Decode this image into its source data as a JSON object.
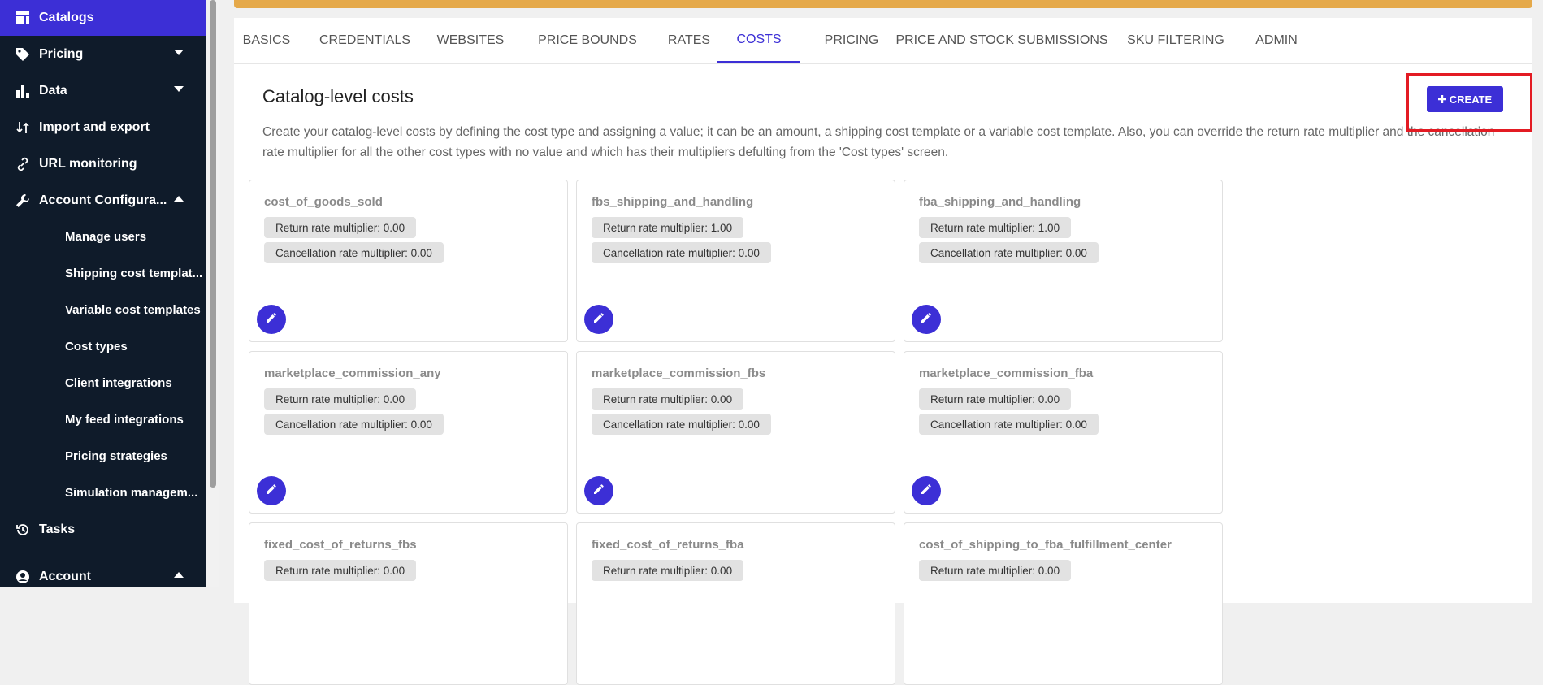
{
  "sidebar": {
    "catalogs": "Catalogs",
    "pricing": "Pricing",
    "data": "Data",
    "import_export": "Import and export",
    "url_monitoring": "URL monitoring",
    "account_config": "Account Configura...",
    "sub": {
      "manage_users": "Manage users",
      "shipping_templates": "Shipping cost templat...",
      "variable_templates": "Variable cost templates",
      "cost_types": "Cost types",
      "client_integrations": "Client integrations",
      "feed_integrations": "My feed integrations",
      "pricing_strategies": "Pricing strategies",
      "simulation": "Simulation managem..."
    },
    "tasks": "Tasks",
    "account": "Account"
  },
  "tabs": {
    "basics": "BASICS",
    "credentials": "CREDENTIALS",
    "websites": "WEBSITES",
    "price_bounds": "PRICE BOUNDS",
    "rates": "RATES",
    "costs": "COSTS",
    "pricing": "PRICING",
    "price_stock": "PRICE AND STOCK SUBMISSIONS",
    "sku_filtering": "SKU FILTERING",
    "admin": "ADMIN"
  },
  "section": {
    "title": "Catalog-level costs",
    "description": "Create your catalog-level costs by defining the cost type and assigning a value; it can be an amount, a shipping cost template or a variable cost template. Also, you can override the return rate multiplier and the cancellation rate multiplier for all the other cost types with no value and which has their multipliers defulting from the 'Cost types' screen.",
    "create_label": "CREATE"
  },
  "cards": [
    {
      "title": "cost_of_goods_sold",
      "return": "Return rate multiplier: 0.00",
      "cancel": "Cancellation rate multiplier: 0.00"
    },
    {
      "title": "fbs_shipping_and_handling",
      "return": "Return rate multiplier: 1.00",
      "cancel": "Cancellation rate multiplier: 0.00"
    },
    {
      "title": "fba_shipping_and_handling",
      "return": "Return rate multiplier: 1.00",
      "cancel": "Cancellation rate multiplier: 0.00"
    },
    {
      "title": "marketplace_commission_any",
      "return": "Return rate multiplier: 0.00",
      "cancel": "Cancellation rate multiplier: 0.00"
    },
    {
      "title": "marketplace_commission_fbs",
      "return": "Return rate multiplier: 0.00",
      "cancel": "Cancellation rate multiplier: 0.00"
    },
    {
      "title": "marketplace_commission_fba",
      "return": "Return rate multiplier: 0.00",
      "cancel": "Cancellation rate multiplier: 0.00"
    },
    {
      "title": "fixed_cost_of_returns_fbs",
      "return": "Return rate multiplier: 0.00"
    },
    {
      "title": "fixed_cost_of_returns_fba",
      "return": "Return rate multiplier: 0.00"
    },
    {
      "title": "cost_of_shipping_to_fba_fulfillment_center",
      "return": "Return rate multiplier: 0.00"
    }
  ]
}
